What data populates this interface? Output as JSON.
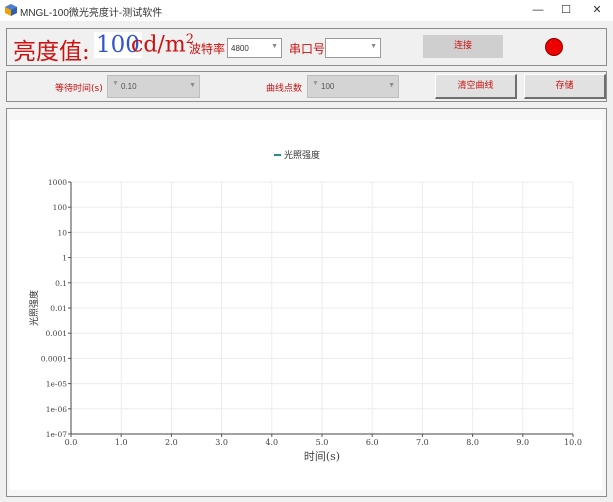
{
  "window": {
    "title": "MNGL-100微光亮度计-测试软件",
    "minimize": "—",
    "maximize": "☐",
    "close": "✕"
  },
  "header": {
    "brightness_label": "亮度值:",
    "brightness_value": "100",
    "unit_main": "cd/m",
    "unit_sup": "2",
    "baud_label": "波特率",
    "baud_value": "4800",
    "port_label": "串口号",
    "port_value": "",
    "connect_label": "连接",
    "status_color": "#ee0000"
  },
  "controls": {
    "wait_label": "等待时间(s)",
    "wait_value": "0.10",
    "points_label": "曲线点数",
    "points_value": "100",
    "clear_label": "清空曲线",
    "save_label": "存储"
  },
  "chart_data": {
    "type": "line",
    "legend": "光照强度",
    "legend_position": "top-center",
    "series_color": "#2a8f8f",
    "xlabel": "时间(s)",
    "ylabel": "光照强度",
    "xlim": [
      0,
      10
    ],
    "ylim": [
      1e-07,
      1000
    ],
    "yscale": "log",
    "grid": true,
    "x_ticks": [
      "0.0",
      "1.0",
      "2.0",
      "3.0",
      "4.0",
      "5.0",
      "6.0",
      "7.0",
      "8.0",
      "9.0",
      "10.0"
    ],
    "y_ticks": [
      "1000",
      "100",
      "10",
      "1",
      "0.1",
      "0.01",
      "0.001",
      "0.0001",
      "1e-05",
      "1e-06",
      "1e-07"
    ],
    "series": [
      {
        "name": "光照强度",
        "x": [],
        "y": []
      }
    ]
  }
}
